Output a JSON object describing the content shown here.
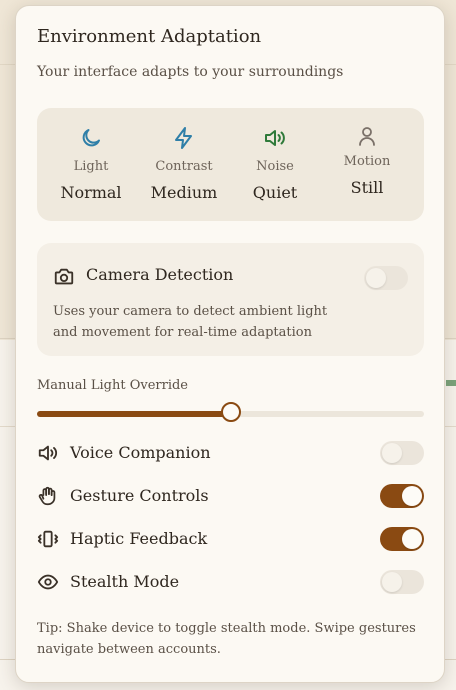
{
  "panel": {
    "title": "Environment Adaptation",
    "subtitle": "Your interface adapts to your surroundings"
  },
  "stats": [
    {
      "icon": "moon-icon",
      "label": "Light",
      "value": "Normal",
      "color": "#2f7fa8"
    },
    {
      "icon": "zap-icon",
      "label": "Contrast",
      "value": "Medium",
      "color": "#2f7fa8"
    },
    {
      "icon": "volume-icon",
      "label": "Noise",
      "value": "Quiet",
      "color": "#2f7a3a"
    },
    {
      "icon": "user-icon",
      "label": "Motion",
      "value": "Still",
      "color": "#7a7068"
    }
  ],
  "camera": {
    "icon": "camera-icon",
    "label": "Camera Detection",
    "enabled": false,
    "description": "Uses your camera to detect ambient light and movement for real-time adaptation"
  },
  "light_override": {
    "label": "Manual Light Override",
    "value": 0.5
  },
  "settings": [
    {
      "icon": "speaker-icon",
      "label": "Voice Companion",
      "enabled": false
    },
    {
      "icon": "hand-icon",
      "label": "Gesture Controls",
      "enabled": true
    },
    {
      "icon": "vibrate-icon",
      "label": "Haptic Feedback",
      "enabled": true
    },
    {
      "icon": "eye-icon",
      "label": "Stealth Mode",
      "enabled": false
    }
  ],
  "tip": "Tip: Shake device to toggle stealth mode. Swipe gestures navigate between accounts.",
  "colors": {
    "accent": "#8a4a12",
    "panel_bg": "#fcf9f3"
  }
}
